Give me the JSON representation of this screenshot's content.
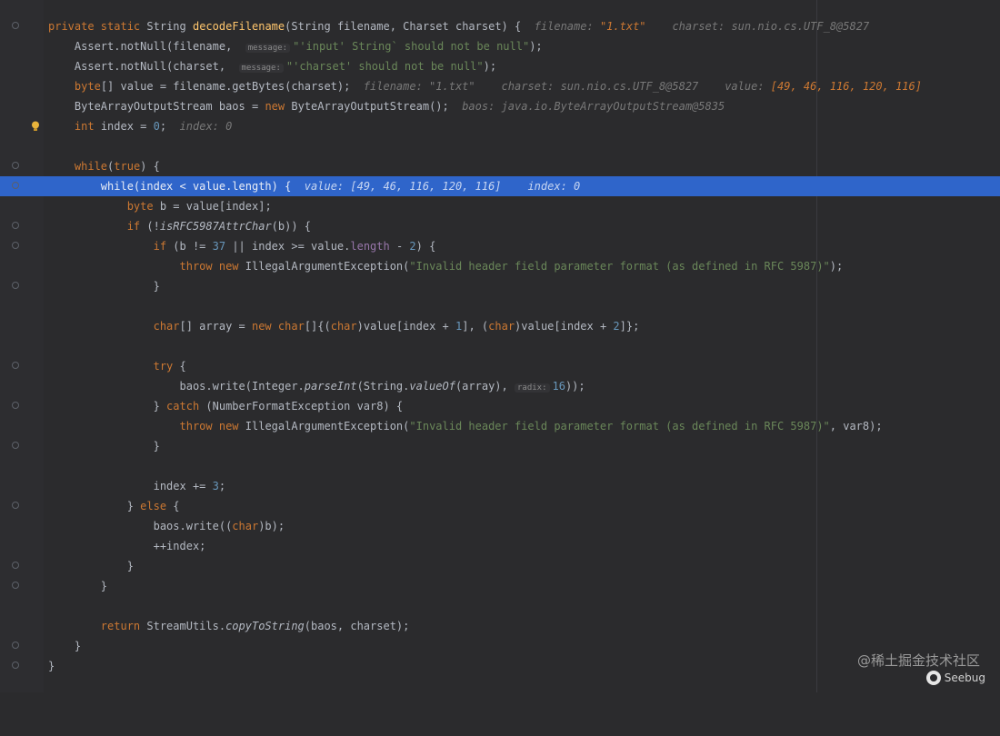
{
  "code": {
    "l1": {
      "mod": "private static",
      "type": "String",
      "fn": "decodeFilename",
      "params": "(String filename, Charset charset) {",
      "hint_name": "filename:",
      "hint_val": "\"1.txt\"",
      "hint2": "charset: sun.nio.cs.UTF_8@5827"
    },
    "l2": {
      "code": "Assert.notNull(filename,",
      "param": "message:",
      "str": "\"'input' String` should not be null\"",
      "tail": ");"
    },
    "l3": {
      "code": "Assert.notNull(charset,",
      "param": "message:",
      "str": "\"'charset' should not be null\"",
      "tail": ");"
    },
    "l4": {
      "kw": "byte",
      "code": "[] value = filename.getBytes(charset);",
      "hint1": "filename: \"1.txt\"",
      "hint2": "charset: sun.nio.cs.UTF_8@5827",
      "hint3_name": "value:",
      "hint3_val": "[49, 46, 116, 120, 116]"
    },
    "l5": {
      "code": "ByteArrayOutputStream baos =",
      "kw": "new",
      "code2": "ByteArrayOutputStream();",
      "hint": "baos: java.io.ByteArrayOutputStream@5835"
    },
    "l6": {
      "kw": "int",
      "code": "index = ",
      "num": "0",
      "tail": ";",
      "hint": "index: 0"
    },
    "l8": {
      "kw": "while",
      "open": "(",
      "kw2": "true",
      "tail": ") {"
    },
    "l9": {
      "kw": "while",
      "code": "(index < value.",
      "fld": "length",
      "tail": ") {",
      "hint1": "value: [49, 46, 116, 120, 116]",
      "hint2": "index: 0"
    },
    "l10": {
      "kw": "byte",
      "code": "b = value[index];"
    },
    "l11": {
      "kw": "if",
      "code": "(!",
      "it": "isRFC5987AttrChar",
      "tail": "(b)) {"
    },
    "l12": {
      "kw": "if",
      "code": "(b != ",
      "num": "37",
      "code2": " || index >= value.",
      "fld": "length",
      "code3": " - ",
      "num2": "2",
      "tail": ") {"
    },
    "l13": {
      "kw": "throw new",
      "code": "IllegalArgumentException(",
      "str": "\"Invalid header field parameter format (as defined in RFC 5987)\"",
      "tail": ");"
    },
    "l14": {
      "code": "}"
    },
    "l16": {
      "kw": "char",
      "code": "[] array = ",
      "kw2": "new",
      "kw3": "char",
      "code2": "[]{(",
      "kw4": "char",
      "code3": ")value[index + ",
      "num": "1",
      "code4": "], (",
      "kw5": "char",
      "code5": ")value[index + ",
      "num2": "2",
      "tail": "]};"
    },
    "l18": {
      "kw": "try",
      "tail": " {"
    },
    "l19": {
      "code": "baos.write(Integer.",
      "it": "parseInt",
      "code2": "(String.",
      "it2": "valueOf",
      "code3": "(array), ",
      "param": "radix:",
      "num": "16",
      "tail": "));"
    },
    "l20": {
      "code": "} ",
      "kw": "catch",
      "tail": " (NumberFormatException var8) {"
    },
    "l21": {
      "kw": "throw new",
      "code": "IllegalArgumentException(",
      "str": "\"Invalid header field parameter format (as defined in RFC 5987)\"",
      "tail": ", var8);"
    },
    "l22": {
      "code": "}"
    },
    "l24": {
      "code": "index += ",
      "num": "3",
      "tail": ";"
    },
    "l25": {
      "code": "} ",
      "kw": "else",
      "tail": " {"
    },
    "l26": {
      "code": "baos.write((",
      "kw": "char",
      "tail": ")b);"
    },
    "l27": {
      "code": "++index;"
    },
    "l28": {
      "code": "}"
    },
    "l29": {
      "code": "}"
    },
    "l31": {
      "kw": "return",
      "code": " StreamUtils.",
      "it": "copyToString",
      "tail": "(baos, charset);"
    },
    "l32": {
      "code": "}"
    },
    "l33": {
      "code": "}"
    }
  },
  "watermark": "@稀土掘金技术社区",
  "seebug": "Seebug"
}
